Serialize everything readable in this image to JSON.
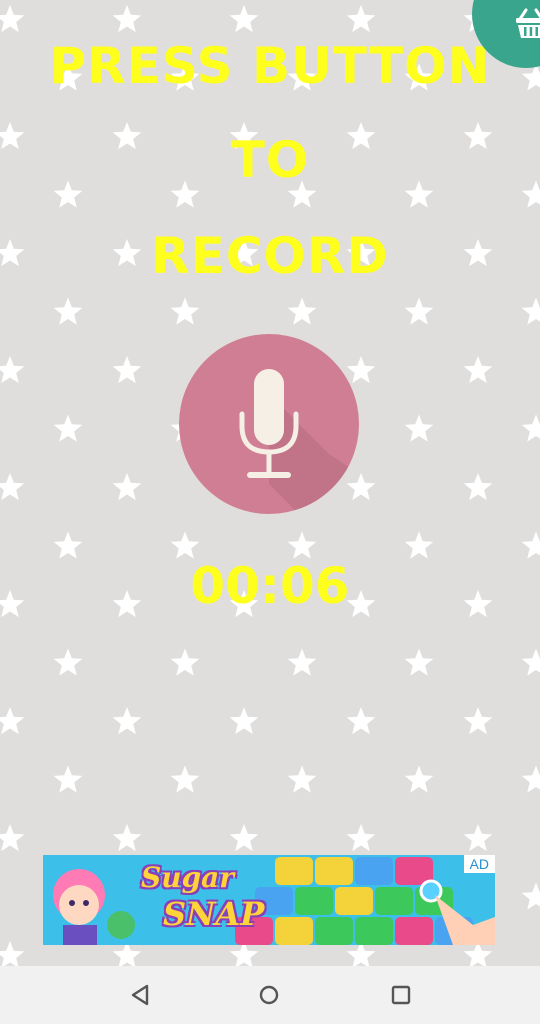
{
  "title": {
    "line1": "PRESS BUTTON",
    "line2": "TO",
    "line3": "RECORD"
  },
  "timer": "00:06",
  "icons": {
    "shop": "basket-icon",
    "record": "microphone-icon",
    "back": "back-triangle-icon",
    "home": "home-circle-icon",
    "recents": "recents-square-icon"
  },
  "ad": {
    "badge": "AD",
    "title_line1": "Sugar",
    "title_line2": "SNAP"
  },
  "colors": {
    "background": "#e0dedc",
    "title_text": "#ffff1e",
    "mic_button": "#d07e93",
    "shop_button": "#3aa58d",
    "ad_background": "#39c3e8"
  }
}
